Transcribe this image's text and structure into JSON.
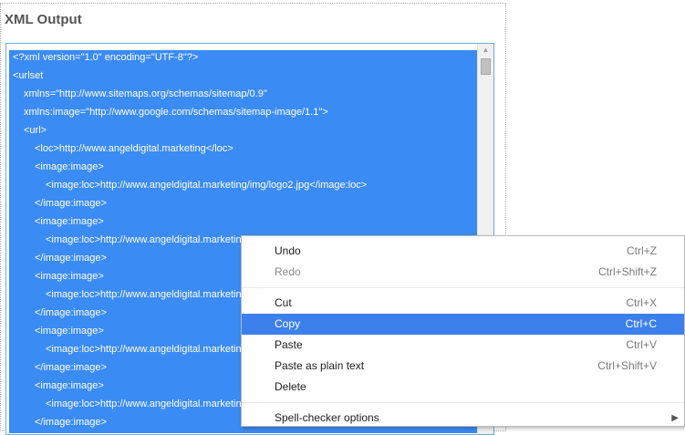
{
  "panel": {
    "title": "XML Output"
  },
  "xml": {
    "lines": [
      "<?xml version=\"1.0\" encoding=\"UTF-8\"?>",
      "<urlset",
      "xmlns=\"http://www.sitemaps.org/schemas/sitemap/0.9\"",
      "xmlns:image=\"http://www.google.com/schemas/sitemap-image/1.1\">",
      "<url>",
      "<loc>http://www.angeldigital.marketing</loc>",
      "<image:image>",
      "<image:loc>http://www.angeldigital.marketing/img/logo2.jpg</image:loc>",
      "</image:image>",
      "<image:image>",
      "<image:loc>http://www.angeldigital.marketing/img/jeremy-gilson.jpg</image:loc>",
      "</image:image>",
      "<image:image>",
      "<image:loc>http://www.angeldigital.marketing",
      "</image:image>",
      "<image:image>",
      "<image:loc>http://www.angeldigital.marketing",
      "</image:image>",
      "<image:image>",
      "<image:loc>http://www.angeldigital.marketing",
      "</image:image>"
    ]
  },
  "context_menu": {
    "undo": {
      "label": "Undo",
      "shortcut": "Ctrl+Z"
    },
    "redo": {
      "label": "Redo",
      "shortcut": "Ctrl+Shift+Z"
    },
    "cut": {
      "label": "Cut",
      "shortcut": "Ctrl+X"
    },
    "copy": {
      "label": "Copy",
      "shortcut": "Ctrl+C"
    },
    "paste": {
      "label": "Paste",
      "shortcut": "Ctrl+V"
    },
    "paste_plain": {
      "label": "Paste as plain text",
      "shortcut": "Ctrl+Shift+V"
    },
    "delete": {
      "label": "Delete"
    },
    "spellcheck": {
      "label": "Spell-checker options"
    }
  },
  "colors": {
    "selection": "#3b8bf5",
    "menu_highlight": "#3c80ec",
    "textarea_border": "#6aaed8"
  }
}
